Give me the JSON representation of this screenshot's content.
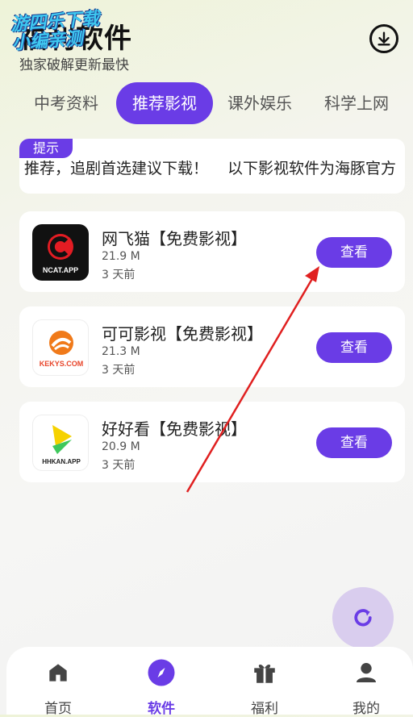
{
  "header": {
    "title": "福利软件",
    "subtitle": "独家破解更新最快",
    "watermark": "游四乐下载\n小编亲测"
  },
  "tabs": [
    {
      "label": "中考资料"
    },
    {
      "label": "推荐影视"
    },
    {
      "label": "课外娱乐"
    },
    {
      "label": "科学上网"
    }
  ],
  "notice": {
    "badge": "提示",
    "text": "推荐，追剧首选建议下载！ 以下影视软件为海豚官方"
  },
  "apps": [
    {
      "name": "网飞猫【免费影视】",
      "size": "21.9 M",
      "time": "3 天前",
      "button": "查看",
      "icon_text": "NCAT.APP"
    },
    {
      "name": "可可影视【免费影视】",
      "size": "21.3 M",
      "time": "3 天前",
      "button": "查看",
      "icon_text": "KEKYS.COM"
    },
    {
      "name": "好好看【免费影视】",
      "size": "20.9 M",
      "time": "3 天前",
      "button": "查看",
      "icon_text": "HHKAN.APP"
    }
  ],
  "bottom_nav": [
    {
      "label": "首页",
      "icon": "home-icon"
    },
    {
      "label": "软件",
      "icon": "compass-icon"
    },
    {
      "label": "福利",
      "icon": "gift-icon"
    },
    {
      "label": "我的",
      "icon": "user-icon"
    }
  ],
  "colors": {
    "accent": "#6a3ce6",
    "annotation_arrow": "#e02020"
  }
}
